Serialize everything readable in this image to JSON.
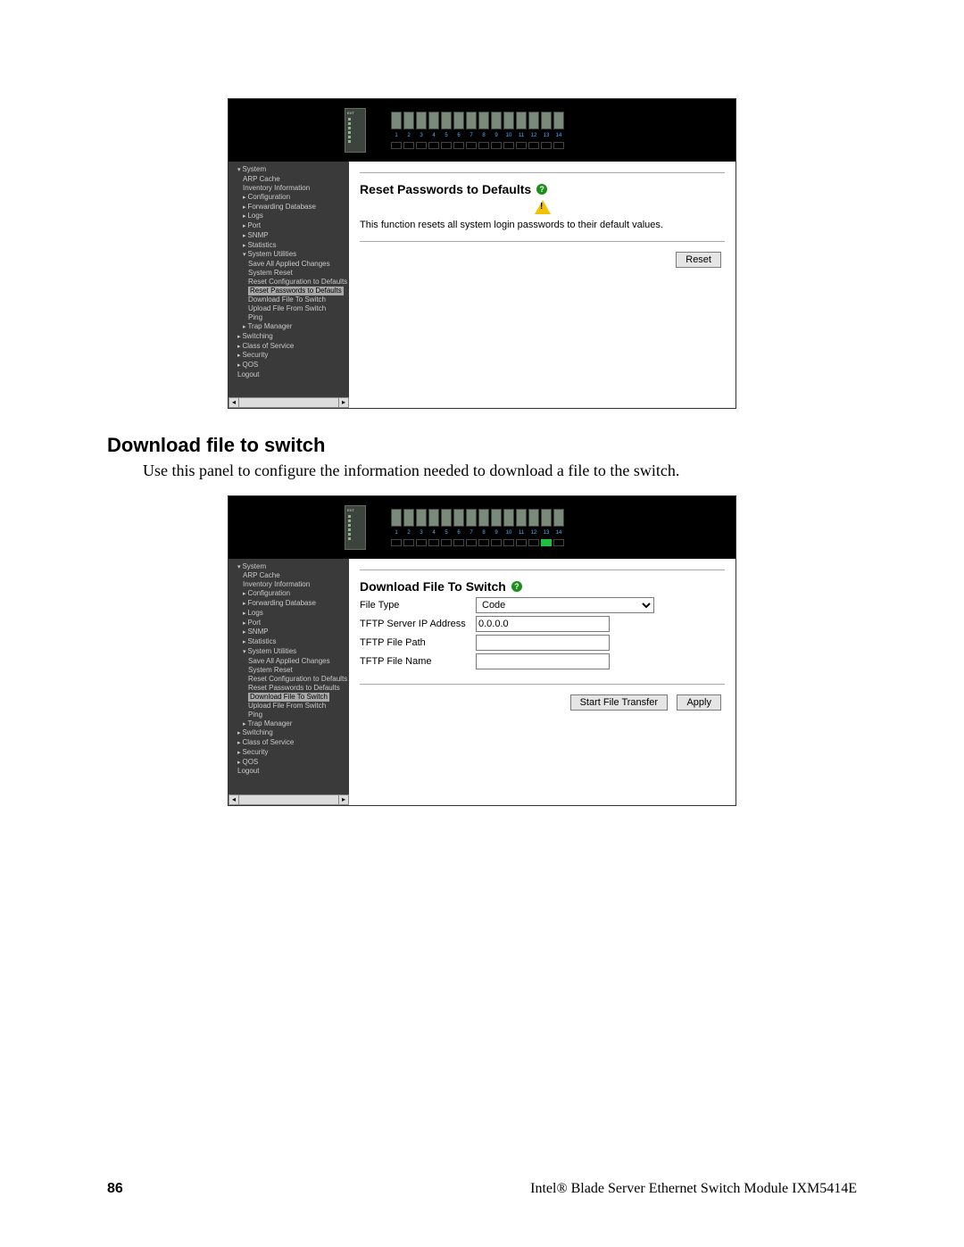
{
  "screenshot_a": {
    "ports": [
      "1",
      "2",
      "3",
      "4",
      "5",
      "6",
      "7",
      "8",
      "9",
      "10",
      "11",
      "12",
      "13",
      "14"
    ],
    "leds_on": [],
    "content": {
      "title": "Reset Passwords to Defaults",
      "desc": "This function resets all system login passwords to their default values.",
      "reset_label": "Reset"
    },
    "nav": [
      {
        "label": "System",
        "cls": "top"
      },
      {
        "label": "ARP Cache",
        "cls": "sub"
      },
      {
        "label": "Inventory Information",
        "cls": "sub"
      },
      {
        "label": "Configuration",
        "cls": "sub caret"
      },
      {
        "label": "Forwarding Database",
        "cls": "sub caret"
      },
      {
        "label": "Logs",
        "cls": "sub caret"
      },
      {
        "label": "Port",
        "cls": "sub caret"
      },
      {
        "label": "SNMP",
        "cls": "sub caret"
      },
      {
        "label": "Statistics",
        "cls": "sub caret"
      },
      {
        "label": "System Utilities",
        "cls": "sub caretdown"
      },
      {
        "label": "Save All Applied Changes",
        "cls": "sub2"
      },
      {
        "label": "System Reset",
        "cls": "sub2"
      },
      {
        "label": "Reset Configuration to Defaults",
        "cls": "sub2"
      },
      {
        "label": "Reset Passwords to Defaults",
        "cls": "selected"
      },
      {
        "label": "Download File To Switch",
        "cls": "sub2"
      },
      {
        "label": "Upload File From Switch",
        "cls": "sub2"
      },
      {
        "label": "Ping",
        "cls": "sub2"
      },
      {
        "label": "Trap Manager",
        "cls": "sub caret"
      },
      {
        "label": "Switching",
        "cls": "caret"
      },
      {
        "label": "Class of Service",
        "cls": "caret"
      },
      {
        "label": "Security",
        "cls": "caret"
      },
      {
        "label": "QOS",
        "cls": "caret"
      },
      {
        "label": "Logout",
        "cls": ""
      }
    ]
  },
  "document": {
    "heading": "Download file to switch",
    "paragraph": "Use this panel to configure the information needed to download a file to the switch."
  },
  "screenshot_b": {
    "ports": [
      "1",
      "2",
      "3",
      "4",
      "5",
      "6",
      "7",
      "8",
      "9",
      "10",
      "11",
      "12",
      "13",
      "14"
    ],
    "leds_on": [
      12
    ],
    "content": {
      "title": "Download File To Switch",
      "file_type_label": "File Type",
      "file_type_value": "Code",
      "tftp_ip_label": "TFTP Server IP Address",
      "tftp_ip_value": "0.0.0.0",
      "tftp_path_label": "TFTP File Path",
      "tftp_path_value": "",
      "tftp_name_label": "TFTP File Name",
      "tftp_name_value": "",
      "start_label": "Start File Transfer",
      "apply_label": "Apply"
    },
    "nav": [
      {
        "label": "System",
        "cls": "top"
      },
      {
        "label": "ARP Cache",
        "cls": "sub"
      },
      {
        "label": "Inventory Information",
        "cls": "sub"
      },
      {
        "label": "Configuration",
        "cls": "sub caret"
      },
      {
        "label": "Forwarding Database",
        "cls": "sub caret"
      },
      {
        "label": "Logs",
        "cls": "sub caret"
      },
      {
        "label": "Port",
        "cls": "sub caret"
      },
      {
        "label": "SNMP",
        "cls": "sub caret"
      },
      {
        "label": "Statistics",
        "cls": "sub caret"
      },
      {
        "label": "System Utilities",
        "cls": "sub caretdown"
      },
      {
        "label": "Save All Applied Changes",
        "cls": "sub2"
      },
      {
        "label": "System Reset",
        "cls": "sub2"
      },
      {
        "label": "Reset Configuration to Defaults",
        "cls": "sub2"
      },
      {
        "label": "Reset Passwords to Defaults",
        "cls": "sub2"
      },
      {
        "label": "Download File To Switch",
        "cls": "selected"
      },
      {
        "label": "Upload File From Switch",
        "cls": "sub2"
      },
      {
        "label": "Ping",
        "cls": "sub2"
      },
      {
        "label": "Trap Manager",
        "cls": "sub caret"
      },
      {
        "label": "Switching",
        "cls": "caret"
      },
      {
        "label": "Class of Service",
        "cls": "caret"
      },
      {
        "label": "Security",
        "cls": "caret"
      },
      {
        "label": "QOS",
        "cls": "caret"
      },
      {
        "label": "Logout",
        "cls": ""
      }
    ]
  },
  "footer": {
    "page_number": "86",
    "title": "Intel® Blade Server Ethernet Switch Module IXM5414E"
  }
}
